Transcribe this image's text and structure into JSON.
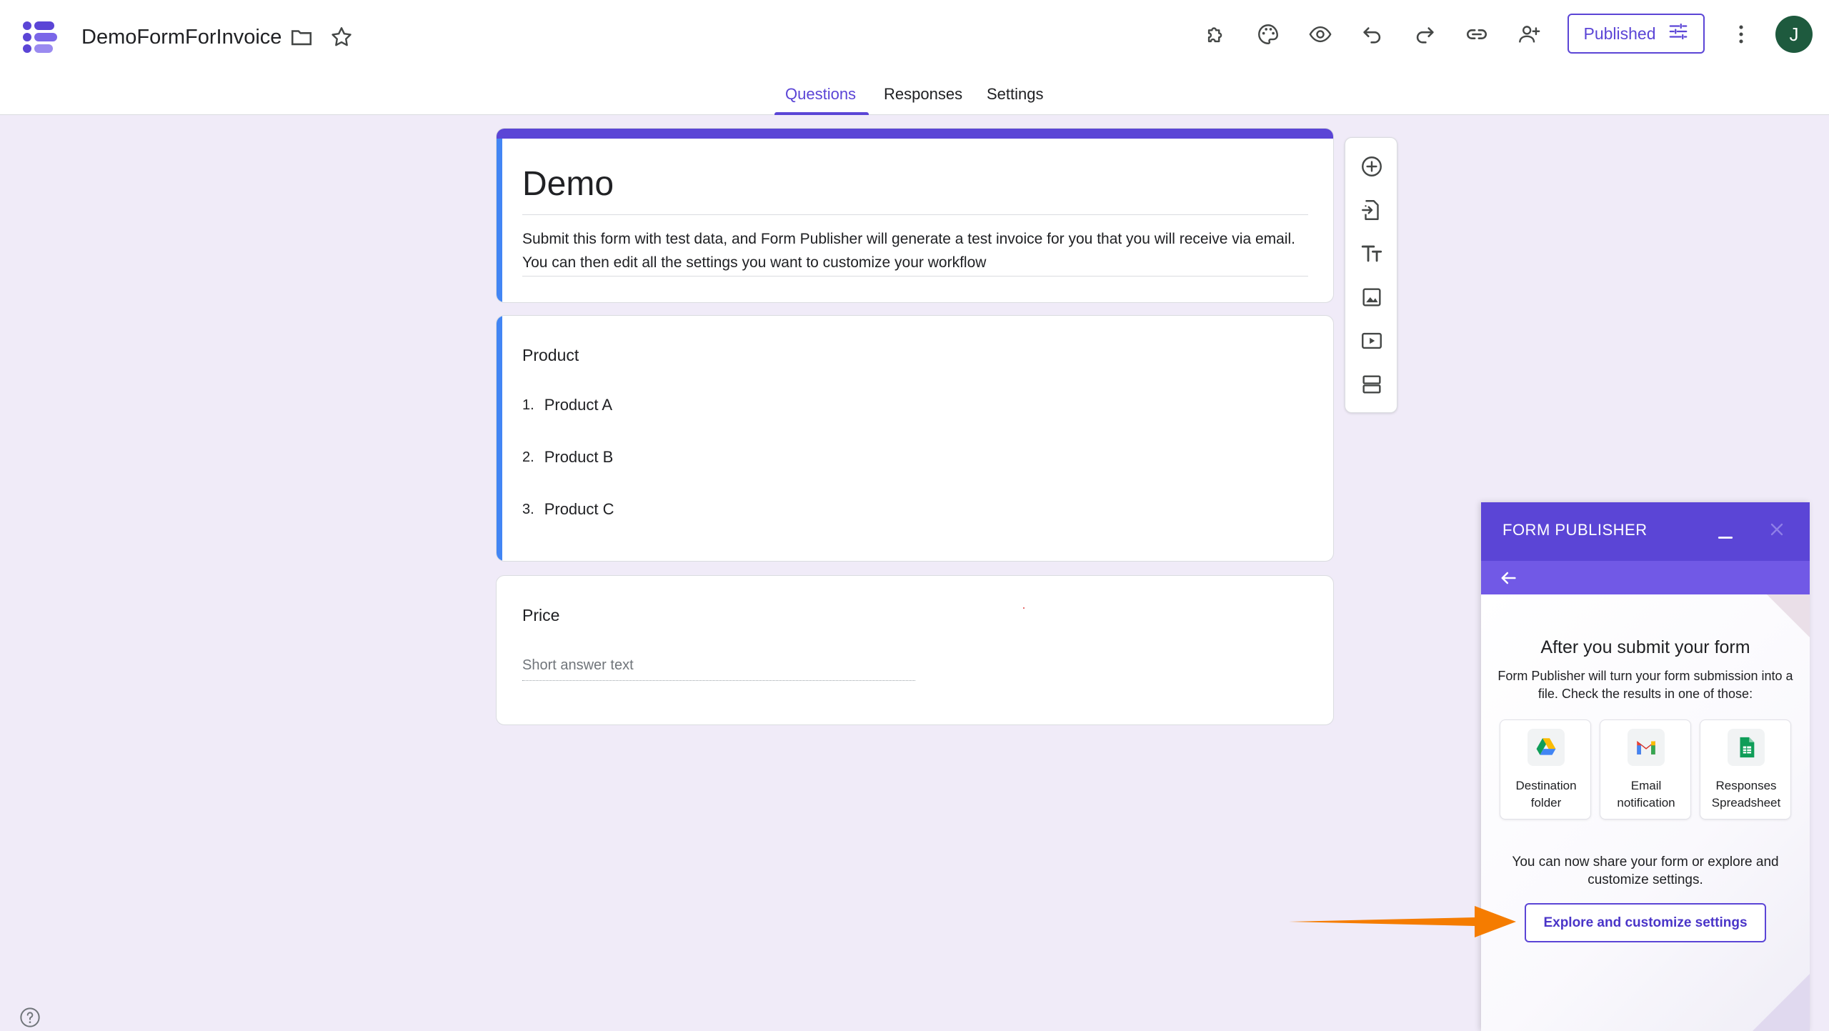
{
  "header": {
    "doc_title": "DemoFormForInvoice",
    "published_label": "Published",
    "avatar_letter": "J",
    "accent_color": "#5b45d6"
  },
  "icons": {
    "app_logo": "forms-logo-icon",
    "folder": "folder-icon",
    "star": "star-icon",
    "addons": "puzzle-icon",
    "theme": "palette-icon",
    "preview": "eye-icon",
    "undo": "undo-icon",
    "redo": "redo-icon",
    "link": "link-icon",
    "collaborators": "add-person-icon",
    "publish_settings": "sliders-icon",
    "more": "more-vert-icon",
    "help": "help-icon"
  },
  "tabs": [
    {
      "label": "Questions",
      "active": true
    },
    {
      "label": "Responses",
      "active": false
    },
    {
      "label": "Settings",
      "active": false
    }
  ],
  "form": {
    "title": "Demo",
    "description": "Submit this form with test data, and Form Publisher will generate a test invoice for you that you will receive via email. You can then edit all the settings you want to customize your workflow",
    "questions": [
      {
        "title": "Product",
        "options": [
          {
            "num": "1.",
            "label": "Product A"
          },
          {
            "num": "2.",
            "label": "Product B"
          },
          {
            "num": "3.",
            "label": "Product C"
          }
        ]
      },
      {
        "title": "Price",
        "placeholder": "Short answer text"
      }
    ]
  },
  "side_toolbar": [
    "add-question-icon",
    "import-questions-icon",
    "add-title-icon",
    "add-image-icon",
    "add-video-icon",
    "add-section-icon"
  ],
  "form_publisher": {
    "header_title": "FORM PUBLISHER",
    "heading": "After you submit your form",
    "text": "Form Publisher will turn your form submission into a file. Check the results in one of those:",
    "cards": [
      {
        "label": "Destination folder",
        "icon": "google-drive-icon"
      },
      {
        "label": "Email notification",
        "icon": "gmail-icon"
      },
      {
        "label": "Responses Spreadsheet",
        "icon": "sheets-icon"
      }
    ],
    "share_text": "You can now share your form or explore and customize settings.",
    "explore_button": "Explore and customize settings"
  }
}
